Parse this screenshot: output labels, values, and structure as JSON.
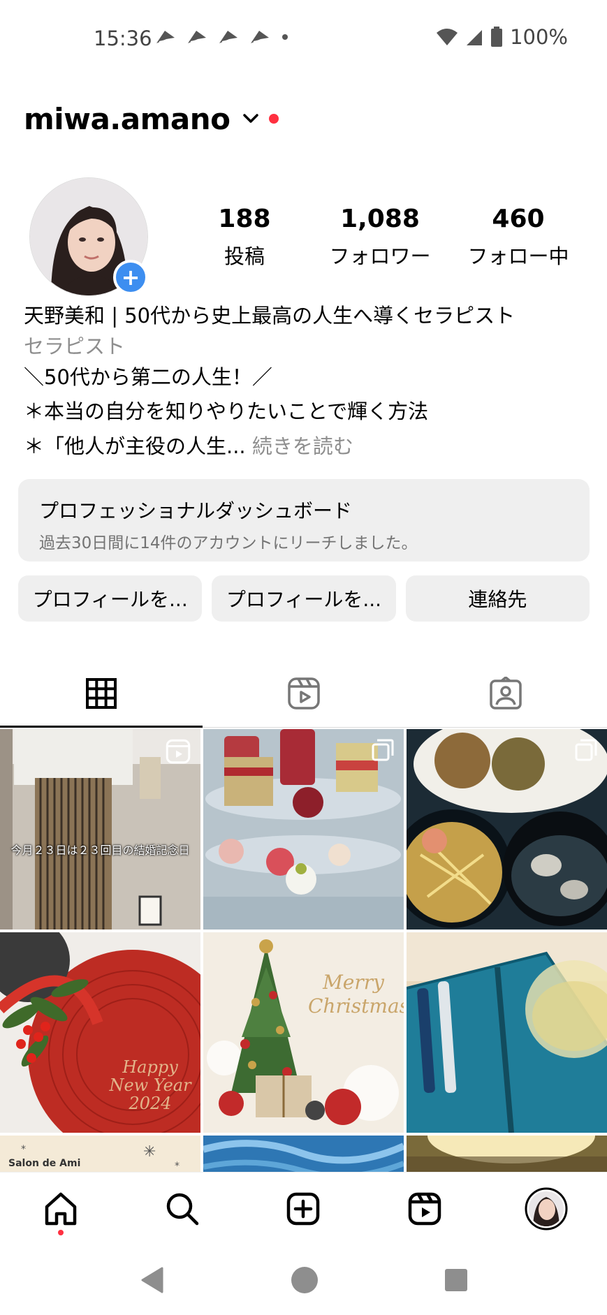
{
  "status_bar": {
    "time": "15:36",
    "battery": "100%"
  },
  "profile": {
    "username": "miwa.amano",
    "stats": [
      {
        "value": "188",
        "label": "投稿"
      },
      {
        "value": "1,088",
        "label": "フォロワー"
      },
      {
        "value": "460",
        "label": "フォロー中"
      }
    ],
    "display_name": "天野美和 | 50代から史上最高の人生へ導くセラピスト",
    "category": "セラピスト",
    "bio_lines": [
      "＼50代から第二の人生！／",
      "＊本当の自分を知りやりたいことで輝く方法",
      "＊「他人が主役の人生..."
    ],
    "more_link": "続きを読む"
  },
  "dashboard": {
    "title": "プロフェッショナルダッシュボード",
    "subtitle": "過去30日間に14件のアカウントにリーチしました。"
  },
  "buttons": [
    "プロフィールを...",
    "プロフィールを...",
    "連絡先"
  ],
  "tabs": [
    "grid-icon",
    "reels-icon",
    "tagged-icon"
  ],
  "posts": [
    {
      "overlay_text": "今月２３日は２３回目の結婚記念日"
    },
    {
      "overlay_text": ""
    },
    {
      "overlay_text": ""
    },
    {
      "overlay_text": "Happy New Year 2024"
    },
    {
      "overlay_text": "Merry Christmas"
    },
    {
      "overlay_text": ""
    },
    {
      "overlay_text": "Salon de Ami"
    },
    {
      "overlay_text": ""
    },
    {
      "overlay_text": ""
    }
  ],
  "bottom_nav": [
    "home-icon",
    "search-icon",
    "create-icon",
    "reels-icon",
    "profile-avatar"
  ]
}
